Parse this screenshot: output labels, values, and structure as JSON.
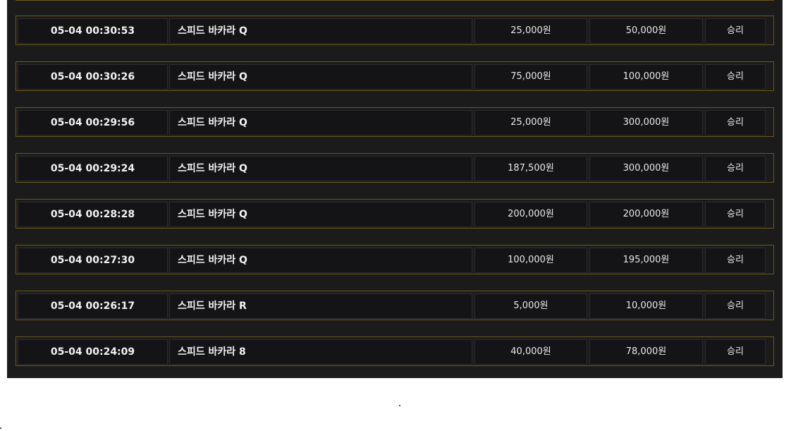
{
  "bet_history": {
    "rows": [
      {
        "time": "05-04 00:30:53",
        "game": "스피드 바카라 Q",
        "bet": "25,000원",
        "win": "50,000원",
        "result": "승리"
      },
      {
        "time": "05-04 00:30:26",
        "game": "스피드 바카라 Q",
        "bet": "75,000원",
        "win": "100,000원",
        "result": "승리"
      },
      {
        "time": "05-04 00:29:56",
        "game": "스피드 바카라 Q",
        "bet": "25,000원",
        "win": "300,000원",
        "result": "승리"
      },
      {
        "time": "05-04 00:29:24",
        "game": "스피드 바카라 Q",
        "bet": "187,500원",
        "win": "300,000원",
        "result": "승리"
      },
      {
        "time": "05-04 00:28:28",
        "game": "스피드 바카라 Q",
        "bet": "200,000원",
        "win": "200,000원",
        "result": "승리"
      },
      {
        "time": "05-04 00:27:30",
        "game": "스피드 바카라 Q",
        "bet": "100,000원",
        "win": "195,000원",
        "result": "승리"
      },
      {
        "time": "05-04 00:26:17",
        "game": "스피드 바카라 R",
        "bet": "5,000원",
        "win": "10,000원",
        "result": "승리"
      },
      {
        "time": "05-04 00:24:09",
        "game": "스피드 바카라 8",
        "bet": "40,000원",
        "win": "78,000원",
        "result": "승리"
      }
    ]
  },
  "colors": {
    "panel_background": "#1c1b1c",
    "cell_background": "#141416",
    "row_border": "#6a5a12",
    "text": "#e8e8e8"
  }
}
